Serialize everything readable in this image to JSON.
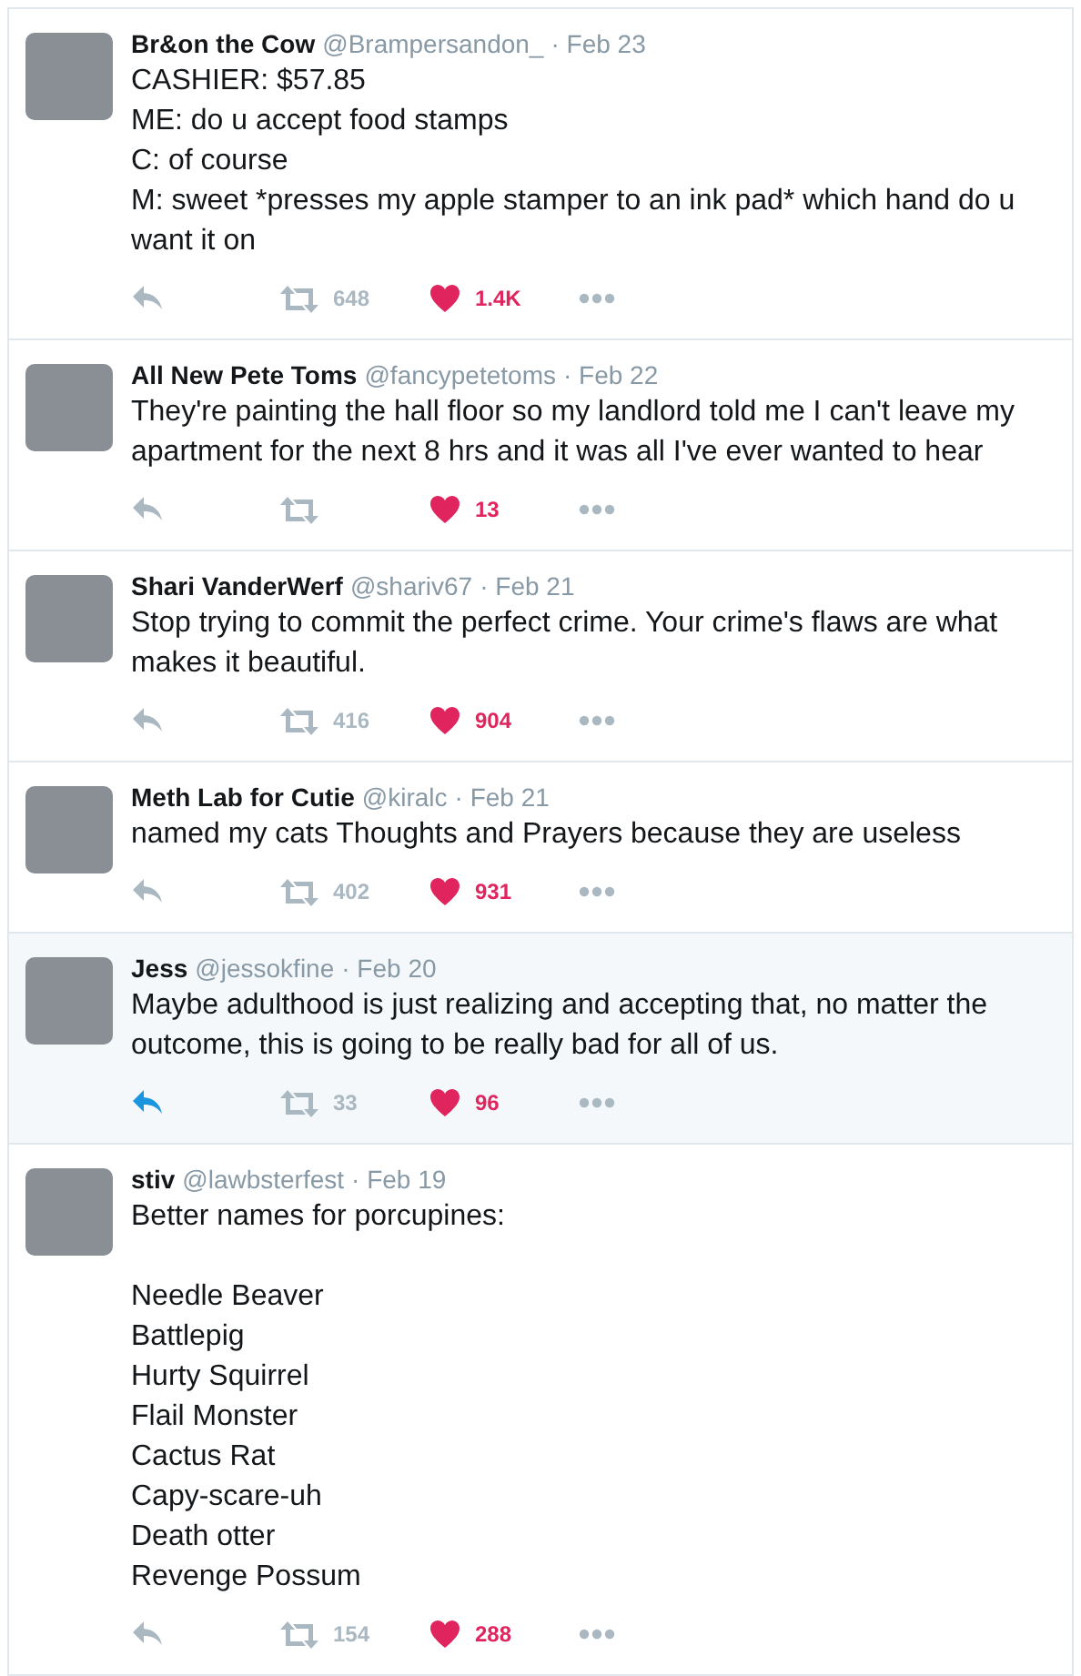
{
  "tweets": [
    {
      "name": "Br&on the Cow",
      "handle": "@Brampersandon_",
      "date": "· Feb 23",
      "highlighted": false,
      "paragraphs": [
        [
          "CASHIER: $57.85",
          "ME: do u accept food stamps",
          "C: of course",
          "M: sweet *presses my apple stamper to an ink pad* which hand do u want it on"
        ]
      ],
      "retweets": "648",
      "likes": "1.4K",
      "liked": true
    },
    {
      "name": "All New Pete Toms",
      "handle": "@fancypetetoms",
      "date": "· Feb 22",
      "highlighted": false,
      "paragraphs": [
        [
          "They're painting the hall floor so my landlord told me I can't leave my apartment for the next 8 hrs and it was all I've ever wanted to hear"
        ]
      ],
      "likes": "13",
      "liked": true
    },
    {
      "name": "Shari VanderWerf",
      "handle": "@shariv67",
      "date": "· Feb 21",
      "highlighted": false,
      "paragraphs": [
        [
          "Stop trying to commit the perfect crime. Your crime's flaws are what makes it beautiful."
        ]
      ],
      "retweets": "416",
      "likes": "904",
      "liked": true
    },
    {
      "name": "Meth Lab for Cutie",
      "handle": "@kiralc",
      "date": "· Feb 21",
      "highlighted": false,
      "paragraphs": [
        [
          "named my cats Thoughts and Prayers because they are useless"
        ]
      ],
      "retweets": "402",
      "likes": "931",
      "liked": true
    },
    {
      "name": "Jess",
      "handle": "@jessokfine",
      "date": "· Feb 20",
      "highlighted": true,
      "paragraphs": [
        [
          "Maybe adulthood is just realizing and accepting that, no matter the outcome, this is going to be really bad for all of us."
        ]
      ],
      "retweets": "33",
      "likes": "96",
      "liked": true
    },
    {
      "name": "stiv",
      "handle": "@lawbsterfest",
      "date": "· Feb 19",
      "highlighted": false,
      "paragraphs": [
        [
          "Better names for porcupines:"
        ],
        [
          "Needle Beaver",
          "Battlepig",
          "Hurty Squirrel",
          "Flail Monster",
          "Cactus Rat",
          "Capy-scare-uh",
          "Death otter",
          "Revenge Possum"
        ]
      ],
      "retweets": "154",
      "likes": "288",
      "liked": true
    }
  ]
}
